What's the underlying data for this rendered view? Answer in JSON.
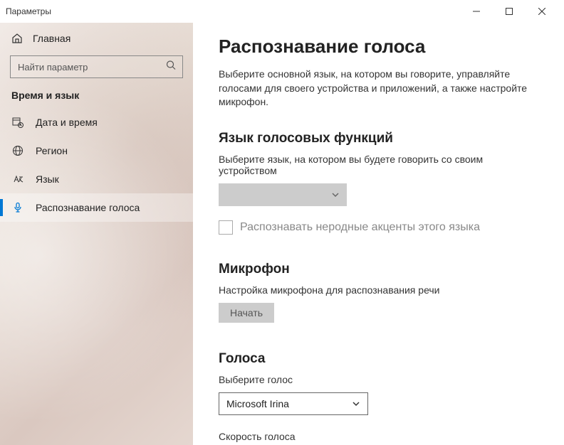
{
  "window": {
    "title": "Параметры"
  },
  "sidebar": {
    "home": "Главная",
    "search_placeholder": "Найти параметр",
    "category": "Время и язык",
    "items": [
      {
        "label": "Дата и время"
      },
      {
        "label": "Регион"
      },
      {
        "label": "Язык"
      },
      {
        "label": "Распознавание голоса"
      }
    ]
  },
  "page": {
    "title": "Распознавание голоса",
    "intro": "Выберите основной язык, на котором вы говорите, управляйте голосами для своего устройства и приложений, а также настройте микрофон.",
    "section_lang": {
      "heading": "Язык голосовых функций",
      "subtext": "Выберите язык, на котором вы будете говорить со своим устройством",
      "checkbox_label": "Распознавать неродные акценты этого языка"
    },
    "section_mic": {
      "heading": "Микрофон",
      "subtext": "Настройка микрофона для распознавания речи",
      "button": "Начать"
    },
    "section_voices": {
      "heading": "Голоса",
      "choose_label": "Выберите голос",
      "selected_voice": "Microsoft Irina",
      "speed_label": "Скорость голоса"
    }
  }
}
